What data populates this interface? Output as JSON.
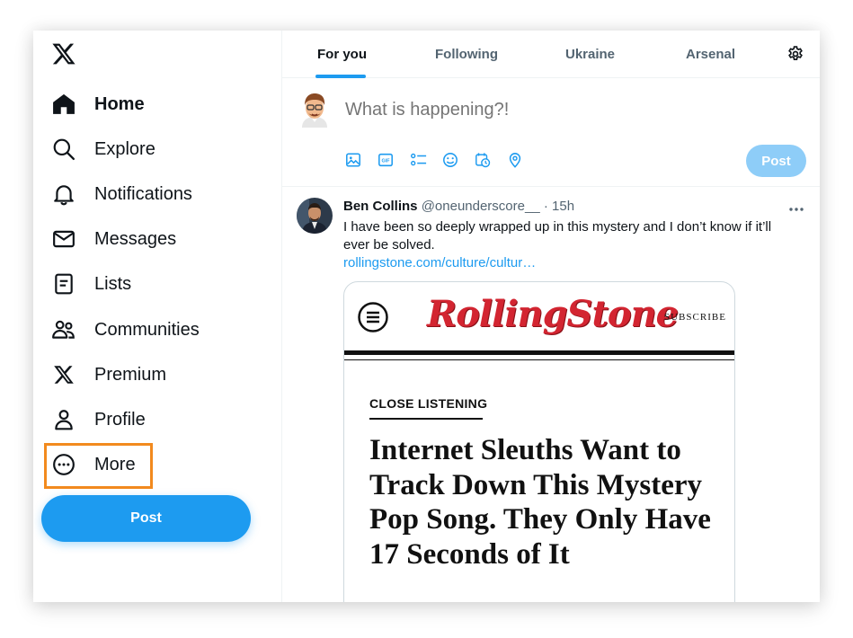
{
  "sidebar": {
    "items": [
      {
        "label": "Home",
        "icon": "home-icon"
      },
      {
        "label": "Explore",
        "icon": "search-icon"
      },
      {
        "label": "Notifications",
        "icon": "bell-icon"
      },
      {
        "label": "Messages",
        "icon": "envelope-icon"
      },
      {
        "label": "Lists",
        "icon": "list-icon"
      },
      {
        "label": "Communities",
        "icon": "communities-icon"
      },
      {
        "label": "Premium",
        "icon": "x-logo-icon"
      },
      {
        "label": "Profile",
        "icon": "person-icon"
      },
      {
        "label": "More",
        "icon": "more-circle-icon"
      }
    ],
    "post_label": "Post",
    "highlight_color": "#f28a1e"
  },
  "tabs": [
    {
      "label": "For you",
      "active": true
    },
    {
      "label": "Following"
    },
    {
      "label": "Ukraine"
    },
    {
      "label": "Arsenal"
    }
  ],
  "composer": {
    "placeholder": "What is happening?!",
    "post_label": "Post",
    "tools": [
      "image-icon",
      "gif-icon",
      "poll-icon",
      "emoji-icon",
      "schedule-icon",
      "location-icon"
    ]
  },
  "tweet": {
    "name": "Ben Collins",
    "handle": "@oneunderscore__",
    "separator": "·",
    "time": "15h",
    "text": "I have been so deeply wrapped up in this mystery and I don’t know if it’ll ever be solved.",
    "link": "rollingstone.com/culture/cultur…",
    "card": {
      "brand": "RollingStone",
      "subscribe": "SUBSCRIBE",
      "kicker": "CLOSE LISTENING",
      "headline": "Internet Sleuths Want to Track Down This Mystery Pop Song. They Only Have 17 Seconds of It"
    }
  },
  "colors": {
    "accent": "#1d9bf0",
    "accent_disabled": "#8ecdf8",
    "brand_red": "#d32531"
  }
}
